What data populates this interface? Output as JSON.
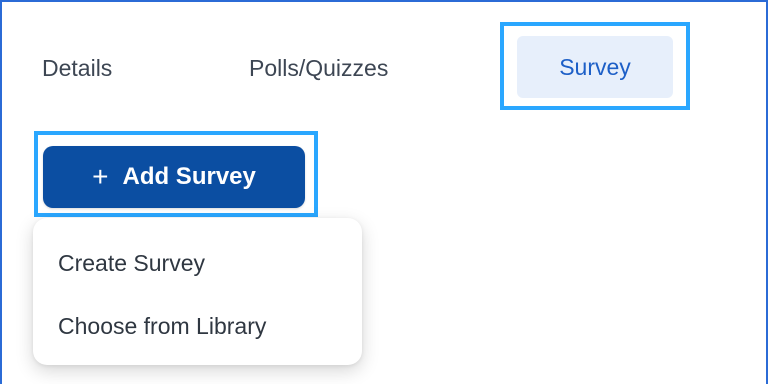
{
  "tabs": [
    {
      "label": "Details"
    },
    {
      "label": "Polls/Quizzes"
    },
    {
      "label": "Survey"
    }
  ],
  "add_button": {
    "icon": "plus-icon",
    "icon_glyph": "+",
    "label": "Add Survey"
  },
  "dropdown": {
    "items": [
      {
        "label": "Create Survey"
      },
      {
        "label": "Choose from Library"
      }
    ]
  },
  "colors": {
    "accent": "#0b4ea2",
    "highlight": "#2aa7ff",
    "active_tab_bg": "#e7effb",
    "active_tab_text": "#1d5fc7"
  }
}
